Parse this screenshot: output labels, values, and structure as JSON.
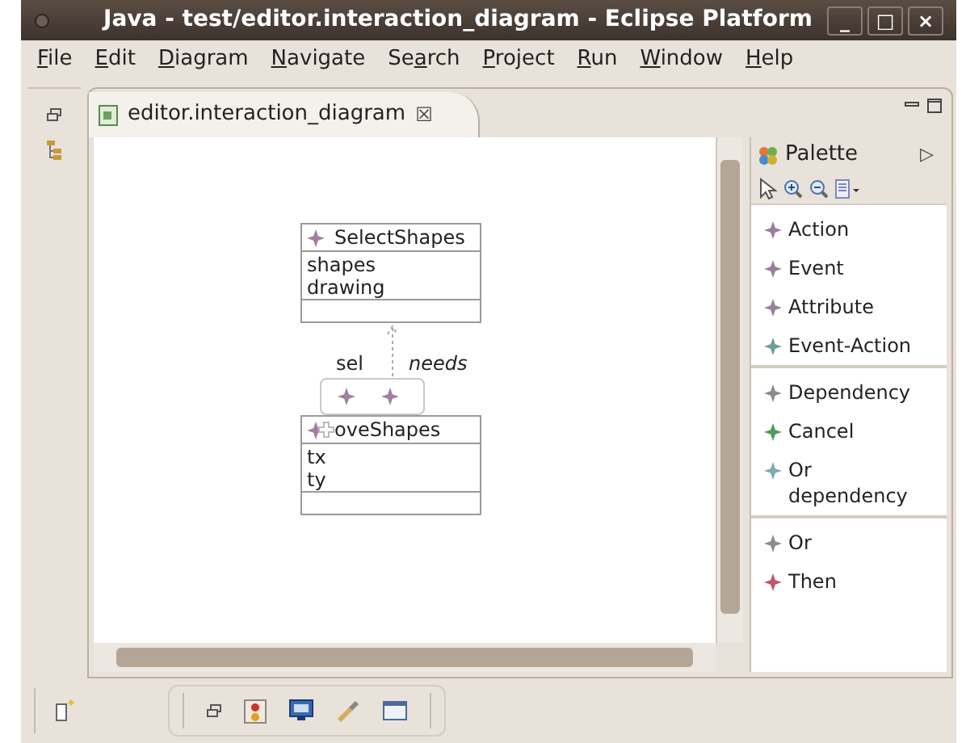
{
  "window": {
    "title": "Java - test/editor.interaction_diagram - Eclipse Platform",
    "controls": [
      "_",
      "□",
      "×"
    ]
  },
  "menu": [
    "File",
    "Edit",
    "Diagram",
    "Navigate",
    "Search",
    "Project",
    "Run",
    "Window",
    "Help"
  ],
  "editor_tab": {
    "label": "editor.interaction_diagram",
    "close": "☒",
    "selected": true
  },
  "diagram": {
    "nodes": [
      {
        "title": "SelectShapes",
        "attributes": [
          "shapes",
          "drawing"
        ]
      },
      {
        "title": "oveShapes",
        "attributes": [
          "tx",
          "ty"
        ]
      }
    ],
    "connector": {
      "labels": [
        "sel",
        "needs"
      ]
    }
  },
  "palette": {
    "title": "Palette",
    "collapse": "▷",
    "groups": [
      [
        {
          "label": "Action",
          "color": "#9a7f9a"
        },
        {
          "label": "Event",
          "color": "#9a7f9a"
        },
        {
          "label": "Attribute",
          "color": "#9a7f9a"
        },
        {
          "label": "Event-Action",
          "color": "#6f9c9c"
        }
      ],
      [
        {
          "label": "Dependency",
          "color": "#8c8c8c"
        },
        {
          "label": "Cancel",
          "color": "#4f9a5c"
        },
        {
          "label": "Or dependency",
          "color": "#7eaab3"
        }
      ],
      [
        {
          "label": "Or",
          "color": "#8c8c8c"
        },
        {
          "label": "Then",
          "color": "#c2566a"
        }
      ]
    ]
  }
}
